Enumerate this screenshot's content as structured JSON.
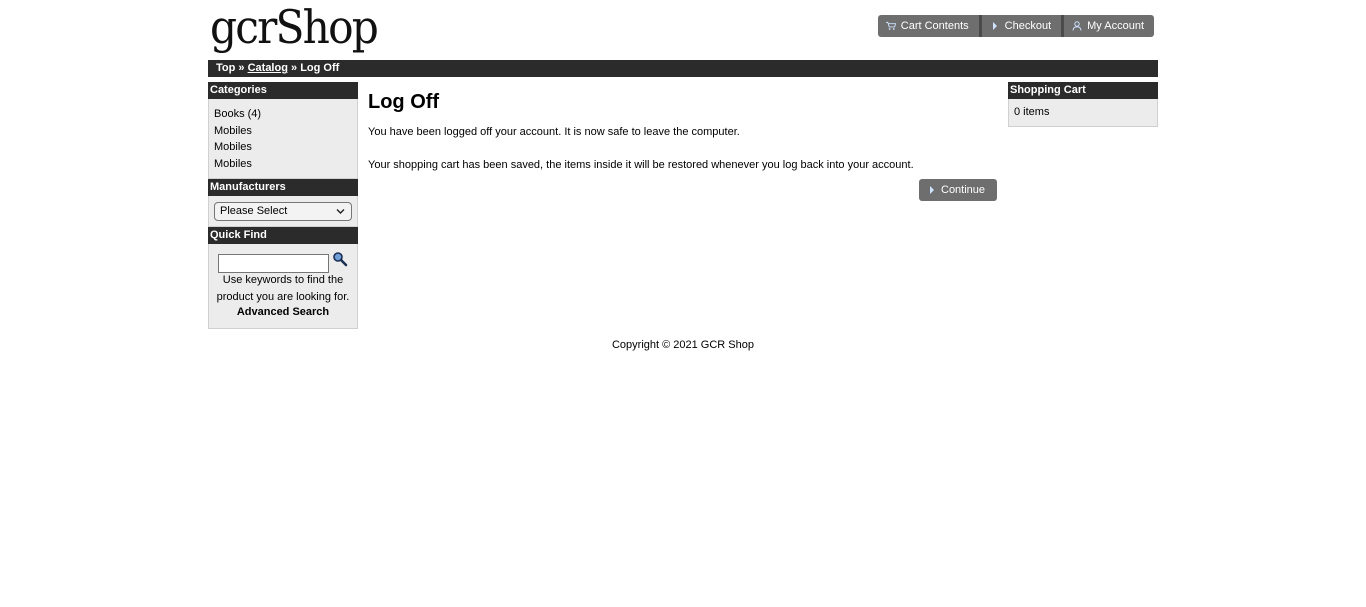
{
  "header": {
    "logo_text": "gcrShop",
    "buttons": [
      {
        "label": "Cart Contents",
        "icon": "cart-icon"
      },
      {
        "label": "Checkout",
        "icon": "triangle-right-icon"
      },
      {
        "label": "My Account",
        "icon": "person-icon"
      }
    ]
  },
  "breadcrumb": {
    "top": "Top",
    "sep": "»",
    "catalog": "Catalog",
    "current": "Log Off"
  },
  "categories": {
    "title": "Categories",
    "items": [
      "Books (4)",
      "Mobiles",
      "Mobiles",
      "Mobiles"
    ]
  },
  "manufacturers": {
    "title": "Manufacturers",
    "selected": "Please Select"
  },
  "quick_find": {
    "title": "Quick Find",
    "input_value": "",
    "help": "Use keywords to find the product you are looking for.",
    "advanced": "Advanced Search"
  },
  "main": {
    "title": "Log Off",
    "message1": "You have been logged off your account. It is now safe to leave the computer.",
    "message2": "Your shopping cart has been saved, the items inside it will be restored whenever you log back into your account.",
    "continue_label": "Continue"
  },
  "shopping_cart": {
    "title": "Shopping Cart",
    "items_text": "0 items"
  },
  "footer": {
    "copyright": "Copyright © 2021 GCR Shop"
  },
  "colors": {
    "header_bar": "#2b2b2b",
    "button_bg": "#6e6e6e",
    "box_bg": "#ececec"
  }
}
